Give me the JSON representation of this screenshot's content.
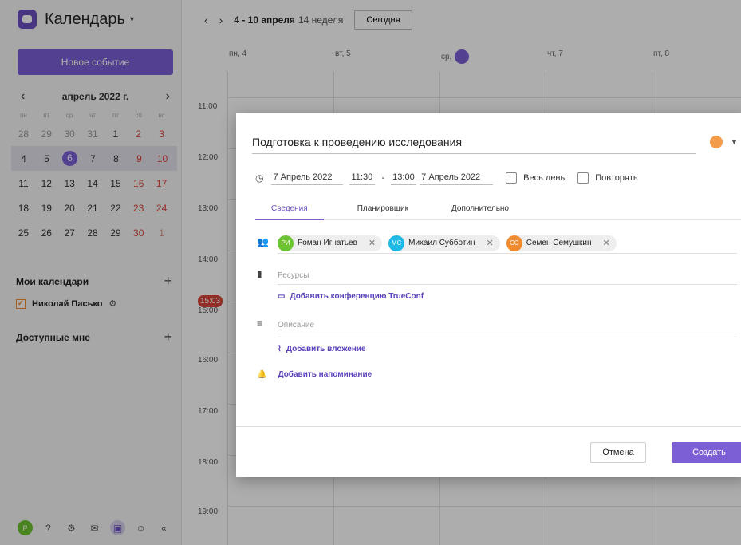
{
  "app": {
    "title": "Календарь",
    "new_event": "Новое событие"
  },
  "mini_calendar": {
    "month": "апрель 2022 г.",
    "weekdays": [
      "пн",
      "вт",
      "ср",
      "чт",
      "пт",
      "сб",
      "вс"
    ],
    "weeks": [
      [
        "28",
        "29",
        "30",
        "31",
        "1",
        "2",
        "3"
      ],
      [
        "4",
        "5",
        "6",
        "7",
        "8",
        "9",
        "10"
      ],
      [
        "11",
        "12",
        "13",
        "14",
        "15",
        "16",
        "17"
      ],
      [
        "18",
        "19",
        "20",
        "21",
        "22",
        "23",
        "24"
      ],
      [
        "25",
        "26",
        "27",
        "28",
        "29",
        "30",
        "1"
      ]
    ]
  },
  "my_calendars": {
    "title": "Мои календари",
    "items": [
      {
        "name": "Николай Пасько"
      }
    ]
  },
  "shared": {
    "title": "Доступные мне"
  },
  "bottom_bar": {
    "avatar": "Р"
  },
  "topbar": {
    "range": "4 - 10 апреля",
    "week": "14 неделя",
    "today": "Сегодня"
  },
  "days": [
    "пн, 4",
    "вт, 5",
    "ср,",
    "чт, 7",
    "пт, 8"
  ],
  "hours": [
    "11:00",
    "12:00",
    "13:00",
    "14:00",
    "15:00",
    "16:00",
    "17:00",
    "18:00",
    "19:00"
  ],
  "current_time": "15:03",
  "dialog": {
    "title": "Подготовка к проведению исследования",
    "color": "#f39c4c",
    "start_date": "7 Апрель 2022",
    "start_time": "11:30",
    "dash": "-",
    "end_time": "13:00",
    "end_date": "7 Апрель 2022",
    "all_day": "Весь день",
    "repeat": "Повторять",
    "tabs": [
      "Сведения",
      "Планировщик",
      "Дополнительно"
    ],
    "participants": [
      {
        "initials": "РИ",
        "name": "Роман Игнатьев",
        "color": "#6cc332"
      },
      {
        "initials": "МС",
        "name": "Михаил Субботин",
        "color": "#1eb8e6"
      },
      {
        "initials": "СС",
        "name": "Семен Семушкин",
        "color": "#f08a2e"
      }
    ],
    "resources_placeholder": "Ресурсы",
    "add_conference": "Добавить конференцию TrueConf",
    "description_placeholder": "Описание",
    "add_attachment": "Добавить вложение",
    "add_reminder": "Добавить напоминание",
    "cancel": "Отмена",
    "create": "Создать"
  }
}
